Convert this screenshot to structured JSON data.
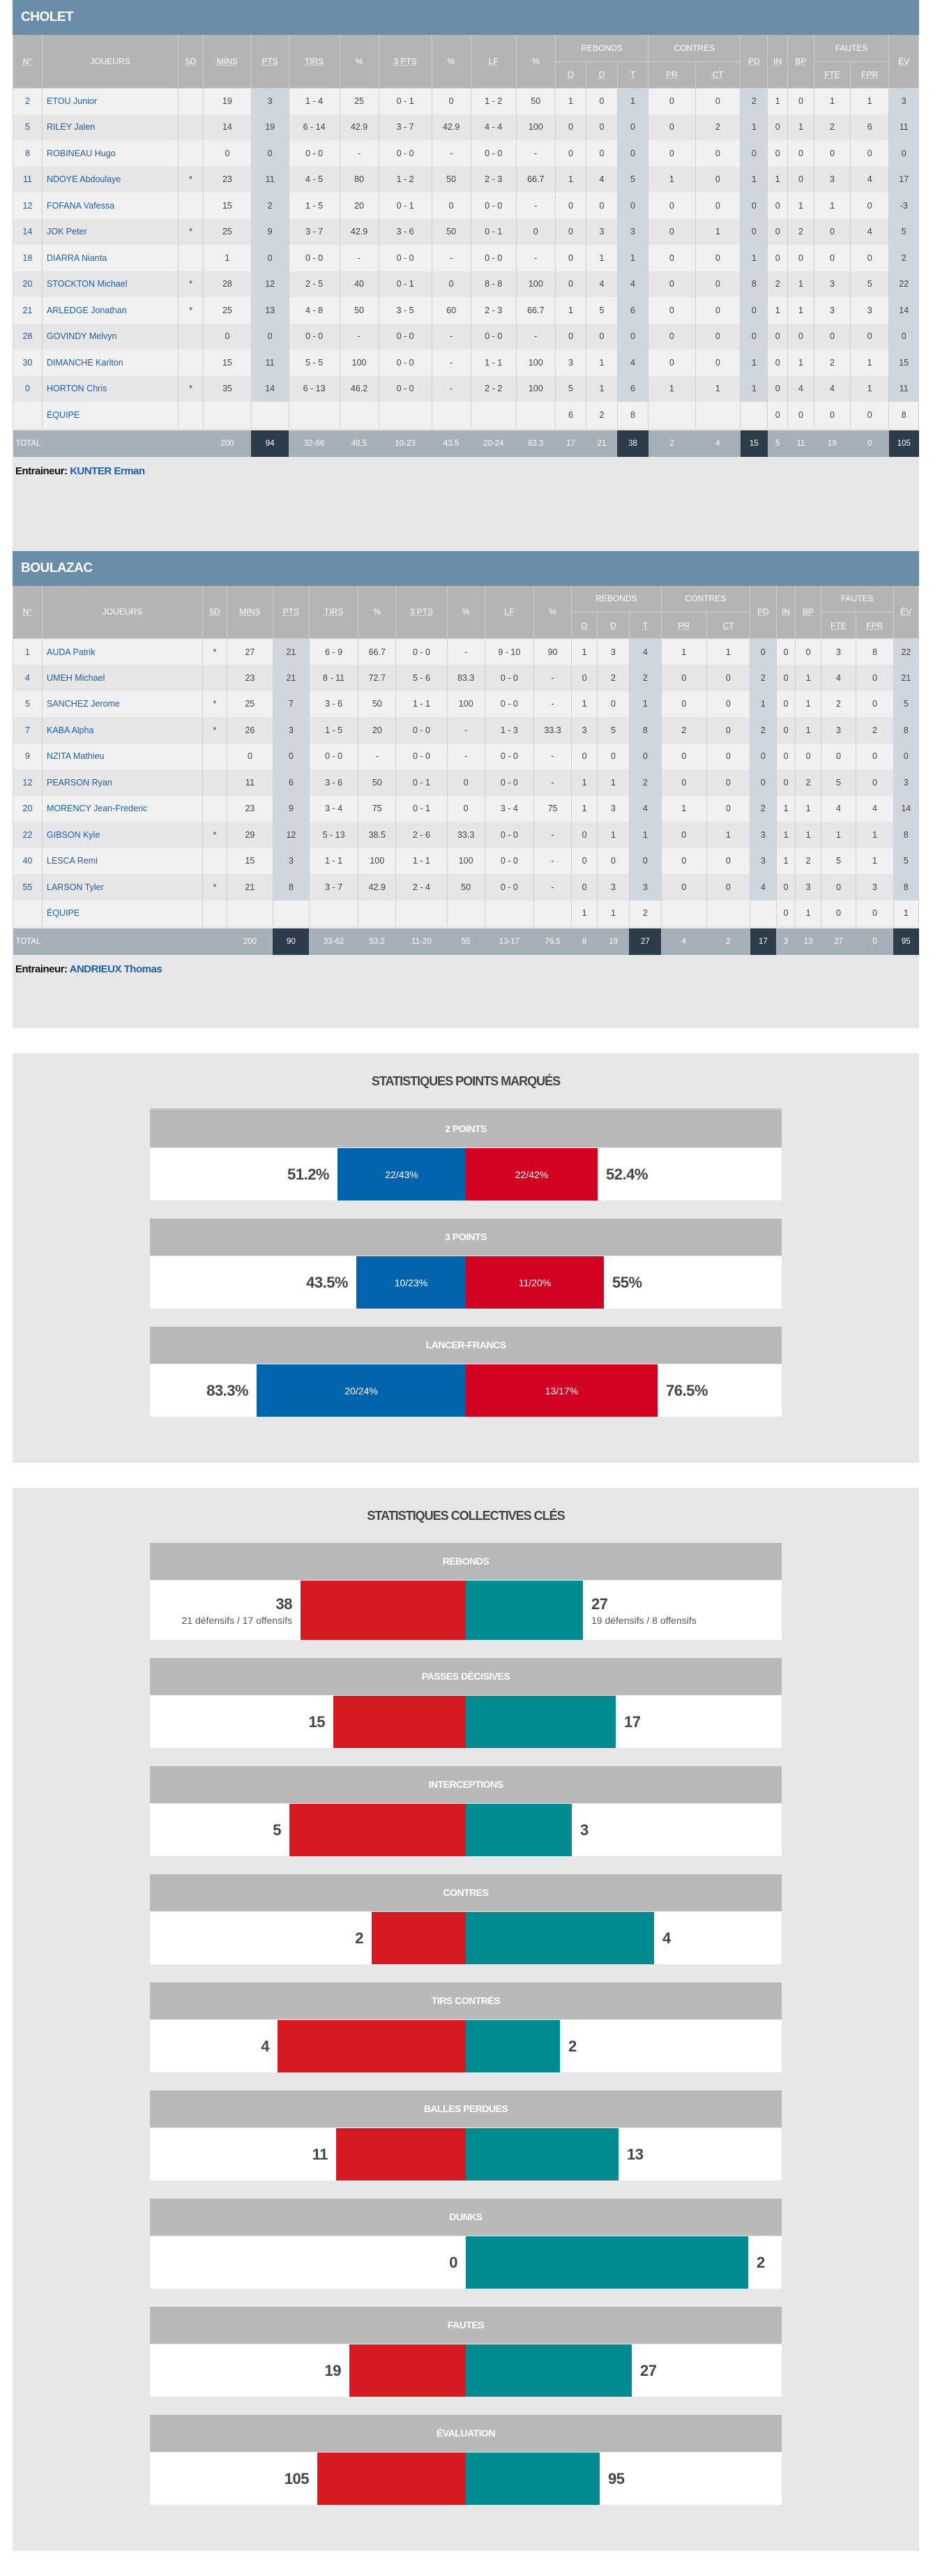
{
  "colors": {
    "team_header": "#6a8ea8",
    "home_bar_pct": "#0063ad",
    "away_bar_pct": "#d1011f",
    "home_bar": "#d61a21",
    "away_bar": "#008b90",
    "link": "#1f5fa8",
    "total_dark": "#2d3c4a"
  },
  "headers": {
    "num": "N°",
    "players": "JOUEURS",
    "five": "5D",
    "mins": "MINS",
    "pts": "PTS",
    "tirs": "TIRS",
    "pct": "%",
    "three": "3 PTS",
    "lf": "LF",
    "rebonds": "REBONDS",
    "o": "O",
    "d": "D",
    "t": "T",
    "contres": "CONTRES",
    "pr": "PR",
    "ct": "CT",
    "pd": "PD",
    "in": "IN",
    "bp": "BP",
    "fautes": "FAUTES",
    "fte": "FTE",
    "fpr": "FPR",
    "ev": "ÉV"
  },
  "teams": [
    {
      "name": "CHOLET",
      "coach_label": "Entraineur:",
      "coach": "KUNTER Erman",
      "team_row_label": "ÉQUIPE",
      "players": [
        [
          "2",
          "ETOU Junior",
          "",
          "19",
          "3",
          "1 - 4",
          "25",
          "0 - 1",
          "0",
          "1 - 2",
          "50",
          "1",
          "0",
          "1",
          "0",
          "0",
          "2",
          "1",
          "0",
          "1",
          "1",
          "3"
        ],
        [
          "5",
          "RILEY Jalen",
          "",
          "14",
          "19",
          "6 - 14",
          "42.9",
          "3 - 7",
          "42.9",
          "4 - 4",
          "100",
          "0",
          "0",
          "0",
          "0",
          "2",
          "1",
          "0",
          "1",
          "2",
          "6",
          "11"
        ],
        [
          "8",
          "ROBINEAU Hugo",
          "",
          "0",
          "0",
          "0 - 0",
          "-",
          "0 - 0",
          "-",
          "0 - 0",
          "-",
          "0",
          "0",
          "0",
          "0",
          "0",
          "0",
          "0",
          "0",
          "0",
          "0",
          "0"
        ],
        [
          "11",
          "NDOYE Abdoulaye",
          "*",
          "23",
          "11",
          "4 - 5",
          "80",
          "1 - 2",
          "50",
          "2 - 3",
          "66.7",
          "1",
          "4",
          "5",
          "1",
          "0",
          "1",
          "1",
          "0",
          "3",
          "4",
          "17"
        ],
        [
          "12",
          "FOFANA Vafessa",
          "",
          "15",
          "2",
          "1 - 5",
          "20",
          "0 - 1",
          "0",
          "0 - 0",
          "-",
          "0",
          "0",
          "0",
          "0",
          "0",
          "0",
          "0",
          "1",
          "1",
          "0",
          "-3"
        ],
        [
          "14",
          "JOK Peter",
          "*",
          "25",
          "9",
          "3 - 7",
          "42.9",
          "3 - 6",
          "50",
          "0 - 1",
          "0",
          "0",
          "3",
          "3",
          "0",
          "1",
          "0",
          "0",
          "2",
          "0",
          "4",
          "5"
        ],
        [
          "18",
          "DIARRA Nianta",
          "",
          "1",
          "0",
          "0 - 0",
          "-",
          "0 - 0",
          "-",
          "0 - 0",
          "-",
          "0",
          "1",
          "1",
          "0",
          "0",
          "1",
          "0",
          "0",
          "0",
          "0",
          "2"
        ],
        [
          "20",
          "STOCKTON Michael",
          "*",
          "28",
          "12",
          "2 - 5",
          "40",
          "0 - 1",
          "0",
          "8 - 8",
          "100",
          "0",
          "4",
          "4",
          "0",
          "0",
          "8",
          "2",
          "1",
          "3",
          "5",
          "22"
        ],
        [
          "21",
          "ARLEDGE Jonathan",
          "*",
          "25",
          "13",
          "4 - 8",
          "50",
          "3 - 5",
          "60",
          "2 - 3",
          "66.7",
          "1",
          "5",
          "6",
          "0",
          "0",
          "0",
          "1",
          "1",
          "3",
          "3",
          "14"
        ],
        [
          "28",
          "GOVINDY Melvyn",
          "",
          "0",
          "0",
          "0 - 0",
          "-",
          "0 - 0",
          "-",
          "0 - 0",
          "-",
          "0",
          "0",
          "0",
          "0",
          "0",
          "0",
          "0",
          "0",
          "0",
          "0",
          "0"
        ],
        [
          "30",
          "DIMANCHE Karlton",
          "",
          "15",
          "11",
          "5 - 5",
          "100",
          "0 - 0",
          "-",
          "1 - 1",
          "100",
          "3",
          "1",
          "4",
          "0",
          "0",
          "1",
          "0",
          "1",
          "2",
          "1",
          "15"
        ],
        [
          "0",
          "HORTON Chris",
          "*",
          "35",
          "14",
          "6 - 13",
          "46.2",
          "0 - 0",
          "-",
          "2 - 2",
          "100",
          "5",
          "1",
          "6",
          "1",
          "1",
          "1",
          "0",
          "4",
          "4",
          "1",
          "11"
        ]
      ],
      "team_row": [
        "",
        "",
        "",
        "",
        "",
        "",
        "",
        "",
        "",
        "6",
        "2",
        "8",
        "",
        "",
        "",
        "0",
        "0",
        "0",
        "0",
        "8"
      ],
      "total": [
        "TOTAL",
        "200",
        "94",
        "32-66",
        "48.5",
        "10-23",
        "43.5",
        "20-24",
        "83.3",
        "17",
        "21",
        "38",
        "2",
        "4",
        "15",
        "5",
        "11",
        "19",
        "0",
        "105"
      ]
    },
    {
      "name": "BOULAZAC",
      "coach_label": "Entraineur:",
      "coach": "ANDRIEUX Thomas",
      "team_row_label": "ÉQUIPE",
      "players": [
        [
          "1",
          "AUDA Patrik",
          "*",
          "27",
          "21",
          "6 - 9",
          "66.7",
          "0 - 0",
          "-",
          "9 - 10",
          "90",
          "1",
          "3",
          "4",
          "1",
          "1",
          "0",
          "0",
          "0",
          "3",
          "8",
          "22"
        ],
        [
          "4",
          "UMEH Michael",
          "",
          "23",
          "21",
          "8 - 11",
          "72.7",
          "5 - 6",
          "83.3",
          "0 - 0",
          "-",
          "0",
          "2",
          "2",
          "0",
          "0",
          "2",
          "0",
          "1",
          "4",
          "0",
          "21"
        ],
        [
          "5",
          "SANCHEZ Jerome",
          "*",
          "25",
          "7",
          "3 - 6",
          "50",
          "1 - 1",
          "100",
          "0 - 0",
          "-",
          "1",
          "0",
          "1",
          "0",
          "0",
          "1",
          "0",
          "1",
          "2",
          "0",
          "5"
        ],
        [
          "7",
          "KABA Alpha",
          "*",
          "26",
          "3",
          "1 - 5",
          "20",
          "0 - 0",
          "-",
          "1 - 3",
          "33.3",
          "3",
          "5",
          "8",
          "2",
          "0",
          "2",
          "0",
          "1",
          "3",
          "2",
          "8"
        ],
        [
          "9",
          "NZITA Mathieu",
          "",
          "0",
          "0",
          "0 - 0",
          "-",
          "0 - 0",
          "-",
          "0 - 0",
          "-",
          "0",
          "0",
          "0",
          "0",
          "0",
          "0",
          "0",
          "0",
          "0",
          "0",
          "0"
        ],
        [
          "12",
          "PEARSON Ryan",
          "",
          "11",
          "6",
          "3 - 6",
          "50",
          "0 - 1",
          "0",
          "0 - 0",
          "-",
          "1",
          "1",
          "2",
          "0",
          "0",
          "0",
          "0",
          "2",
          "5",
          "0",
          "3"
        ],
        [
          "20",
          "MORENCY Jean-Frederic",
          "",
          "23",
          "9",
          "3 - 4",
          "75",
          "0 - 1",
          "0",
          "3 - 4",
          "75",
          "1",
          "3",
          "4",
          "1",
          "0",
          "2",
          "1",
          "1",
          "4",
          "4",
          "14"
        ],
        [
          "22",
          "GIBSON Kyle",
          "*",
          "29",
          "12",
          "5 - 13",
          "38.5",
          "2 - 6",
          "33.3",
          "0 - 0",
          "-",
          "0",
          "1",
          "1",
          "0",
          "1",
          "3",
          "1",
          "1",
          "1",
          "1",
          "8"
        ],
        [
          "40",
          "LESCA Remi",
          "",
          "15",
          "3",
          "1 - 1",
          "100",
          "1 - 1",
          "100",
          "0 - 0",
          "-",
          "0",
          "0",
          "0",
          "0",
          "0",
          "3",
          "1",
          "2",
          "5",
          "1",
          "5"
        ],
        [
          "55",
          "LARSON Tyler",
          "*",
          "21",
          "8",
          "3 - 7",
          "42.9",
          "2 - 4",
          "50",
          "0 - 0",
          "-",
          "0",
          "3",
          "3",
          "0",
          "0",
          "4",
          "0",
          "3",
          "0",
          "3",
          "8"
        ]
      ],
      "team_row": [
        "",
        "",
        "",
        "",
        "",
        "",
        "",
        "",
        "",
        "1",
        "1",
        "2",
        "",
        "",
        "",
        "0",
        "1",
        "0",
        "0",
        "1"
      ],
      "total": [
        "TOTAL",
        "200",
        "90",
        "33-62",
        "53.2",
        "11-20",
        "55",
        "13-17",
        "76.5",
        "8",
        "19",
        "27",
        "4",
        "2",
        "17",
        "3",
        "13",
        "27",
        "0",
        "95"
      ]
    }
  ],
  "points_section": {
    "title": "STATISTIQUES POINTS MARQUÉS",
    "items": [
      {
        "label": "2 POINTS",
        "home_pct": "51.2%",
        "home_ratio": "22/43%",
        "away_ratio": "22/42%",
        "away_pct": "52.4%",
        "home_value": 51.2,
        "away_value": 52.4
      },
      {
        "label": "3 POINTS",
        "home_pct": "43.5%",
        "home_ratio": "10/23%",
        "away_ratio": "11/20%",
        "away_pct": "55%",
        "home_value": 43.5,
        "away_value": 55
      },
      {
        "label": "LANCER-FRANCS",
        "home_pct": "83.3%",
        "home_ratio": "20/24%",
        "away_ratio": "13/17%",
        "away_pct": "76.5%",
        "home_value": 83.3,
        "away_value": 76.5
      }
    ]
  },
  "collective_section": {
    "title": "STATISTIQUES COLLECTIVES CLÉS",
    "items": [
      {
        "label": "REBONDS",
        "home": "38",
        "away": "27",
        "home_sub": "21 défensifs / 17 offensifs",
        "away_sub": "19 défensifs / 8 offensifs"
      },
      {
        "label": "PASSES DÉCISIVES",
        "home": "15",
        "away": "17"
      },
      {
        "label": "INTERCEPTIONS",
        "home": "5",
        "away": "3"
      },
      {
        "label": "CONTRES",
        "home": "2",
        "away": "4"
      },
      {
        "label": "TIRS CONTRÉS",
        "home": "4",
        "away": "2"
      },
      {
        "label": "BALLES PERDUES",
        "home": "11",
        "away": "13"
      },
      {
        "label": "DUNKS",
        "home": "0",
        "away": "2"
      },
      {
        "label": "FAUTES",
        "home": "19",
        "away": "27"
      },
      {
        "label": "ÉVALUATION",
        "home": "105",
        "away": "95"
      }
    ]
  }
}
